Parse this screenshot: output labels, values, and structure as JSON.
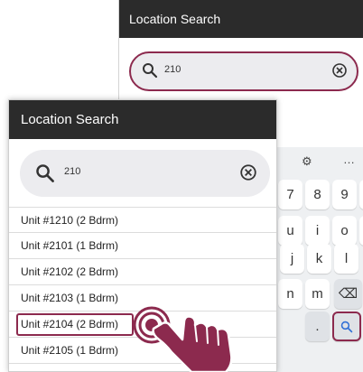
{
  "back": {
    "title": "Location Search",
    "search": {
      "value": "210"
    },
    "keyboard": {
      "toolbar": [
        "⚙",
        "…"
      ],
      "row1": [
        "7",
        "8",
        "9",
        "0"
      ],
      "row2": [
        "u",
        "i",
        "o",
        "p"
      ],
      "row3": [
        "j",
        "k",
        "l"
      ],
      "row4": [
        "n",
        "m",
        "⌫"
      ],
      "row5": [
        ".",
        "search"
      ]
    }
  },
  "front": {
    "title": "Location Search",
    "search": {
      "value": "210"
    },
    "results": [
      "Unit #1210 (2 Bdrm)",
      "Unit #2101 (1 Bdrm)",
      "Unit #2102 (2 Bdrm)",
      "Unit #2103 (1 Bdrm)",
      "Unit #2104 (2 Bdrm)",
      "Unit #2105 (1 Bdrm)"
    ],
    "highlighted_index": 4
  },
  "colors": {
    "accent": "#8c2a4e",
    "app_bar": "#2b2b2b",
    "search_bg": "#ececef"
  },
  "icons": {
    "search": "magnifier-icon",
    "clear": "circle-x-icon",
    "gesture": "tap-hand-icon"
  }
}
